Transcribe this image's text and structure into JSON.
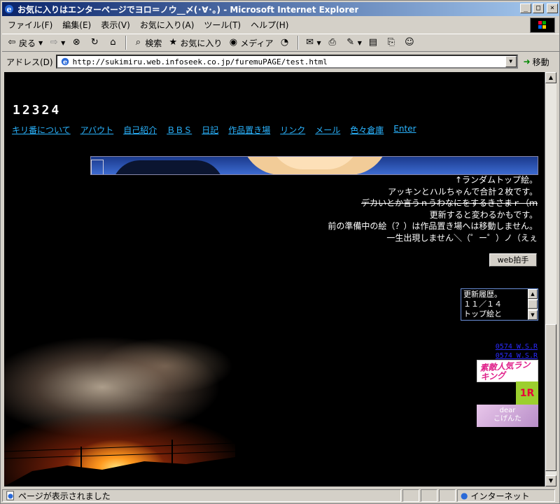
{
  "window": {
    "title": "お気に入りはエンターページでヨロ＝ノウ__〆(･∀･｡) - Microsoft Internet Explorer",
    "controls": {
      "minimize": "_",
      "maximize": "□",
      "close": "×"
    }
  },
  "menu": {
    "items": [
      "ファイル(F)",
      "編集(E)",
      "表示(V)",
      "お気に入り(A)",
      "ツール(T)",
      "ヘルプ(H)"
    ]
  },
  "toolbar": {
    "back_label": "戻る",
    "search_label": "検索",
    "favorites_label": "お気に入り",
    "media_label": "メディア"
  },
  "address": {
    "label": "アドレス(D)",
    "url": "http://sukimiru.web.infoseek.co.jp/furemuPAGE/test.html",
    "go_label": "移動"
  },
  "page": {
    "counter": "12324",
    "nav": [
      "キリ番について",
      "アバウト",
      "自己紹介",
      "ＢＢＳ",
      "日記",
      "作品置き場",
      "リンク",
      "メール",
      "色々倉庫",
      "Enter"
    ],
    "notes": [
      "↑ランダムトップ絵。",
      "アッキンとハルちゃんで合計２枚です。",
      "デカいとか言うｎうわなにをするきさまｒ（ｍ",
      "更新すると変わるかもです。",
      "前の準備中の絵（？）は作品置き場へは移動しません。",
      "一生出現しません＼（゜ー゜）ノ（えぇ"
    ],
    "clap_button": "web拍手",
    "history": [
      "更新履歴。",
      "１１／１４",
      "トップ絵と"
    ],
    "small_links": [
      "0574 W.S.R",
      "0574 W.S.R"
    ],
    "rank1_text": "素敵人気ランキング",
    "rank2_text": "1R",
    "dear_text": [
      "dear",
      "こげんた"
    ]
  },
  "status": {
    "text": "ページが表示されました",
    "zone": "インターネット"
  }
}
